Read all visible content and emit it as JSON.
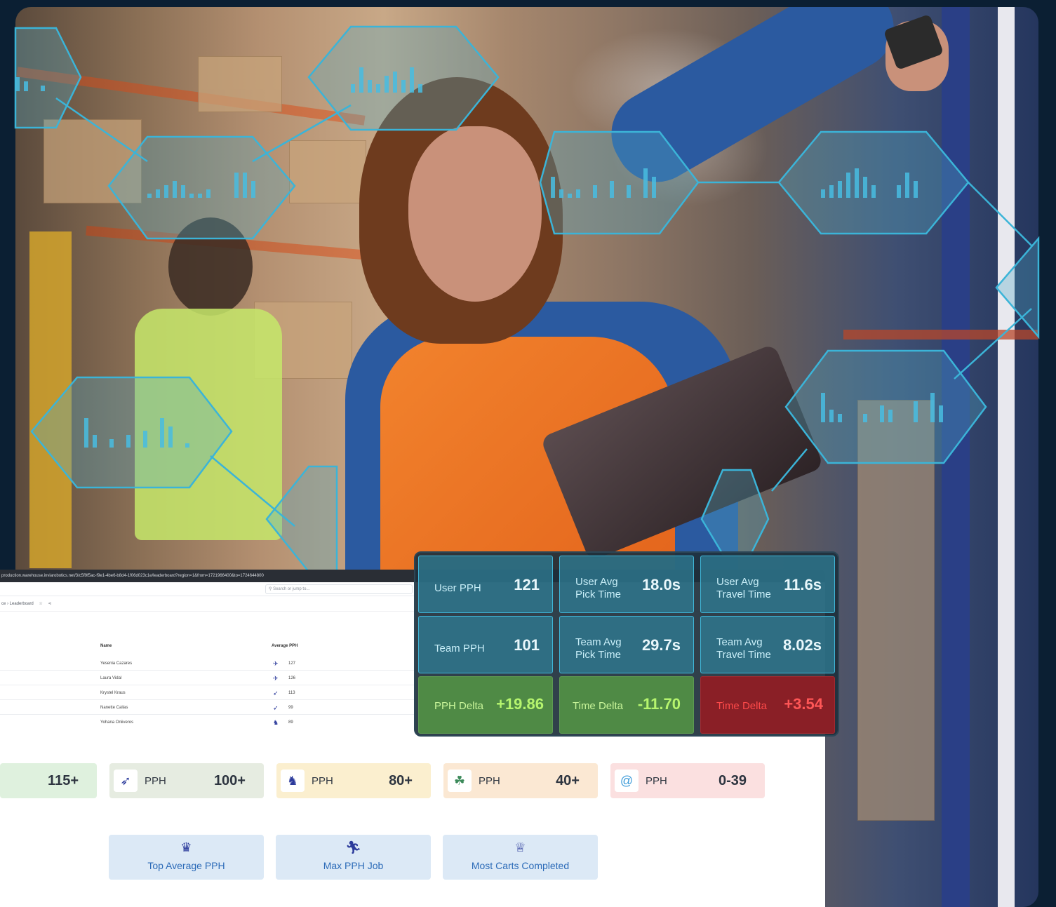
{
  "browser": {
    "url": "production.warehouse.inviarobotics.net/3/c5f9f5ac-f9e1-4be6-b8d4-1f06d023c1e/leaderboard?region=1&from=1721966400&to=1724644800",
    "search_placeholder": "Search or jump to...",
    "breadcrumb": "ce › Leaderboard"
  },
  "leaderboard": {
    "name_header": "Name",
    "avg_header": "Average PPH",
    "rows": [
      {
        "name": "Yesenia Cazares",
        "icon": "jet-icon",
        "value": "127"
      },
      {
        "name": "Laura Vidal",
        "icon": "jet-icon",
        "value": "126"
      },
      {
        "name": "Krystel Kraus",
        "icon": "cheetah-icon",
        "value": "113"
      },
      {
        "name": "Nanette Callas",
        "icon": "cheetah-icon",
        "value": "99"
      },
      {
        "name": "Yohana Oniiveros",
        "icon": "rabbit-icon",
        "value": "89"
      }
    ]
  },
  "tiers": [
    {
      "label": "",
      "value": "115+",
      "icon": "",
      "color": "#dff1de"
    },
    {
      "label": "PPH",
      "value": "100+",
      "icon": "cheetah-icon",
      "color": "#e6ece1"
    },
    {
      "label": "PPH",
      "value": "80+",
      "icon": "rabbit-icon",
      "color": "#fbefcf"
    },
    {
      "label": "PPH",
      "value": "40+",
      "icon": "turtle-icon",
      "color": "#fbe8d3"
    },
    {
      "label": "PPH",
      "value": "0-39",
      "icon": "snail-icon",
      "color": "#fbe0e0"
    }
  ],
  "awards": [
    {
      "label": "Top Average PPH",
      "icon": "crown-icon"
    },
    {
      "label": "Max PPH Job",
      "icon": "runner-icon"
    },
    {
      "label": "Most Carts Completed",
      "icon": "trophy-icon"
    }
  ],
  "metrics": [
    {
      "label": "User PPH",
      "value": "121",
      "tone": "teal"
    },
    {
      "label": "User Avg Pick Time",
      "value": "18.0s",
      "tone": "teal"
    },
    {
      "label": "User Avg Travel Time",
      "value": "11.6s",
      "tone": "teal"
    },
    {
      "label": "Team PPH",
      "value": "101",
      "tone": "teal"
    },
    {
      "label": "Team Avg Pick Time",
      "value": "29.7s",
      "tone": "teal"
    },
    {
      "label": "Team Avg Travel Time",
      "value": "8.02s",
      "tone": "teal"
    },
    {
      "label": "PPH Delta",
      "value": "+19.86",
      "tone": "green"
    },
    {
      "label": "Time Delta",
      "value": "-11.70",
      "tone": "green"
    },
    {
      "label": "Time Delta",
      "value": "+3.54",
      "tone": "red"
    }
  ]
}
